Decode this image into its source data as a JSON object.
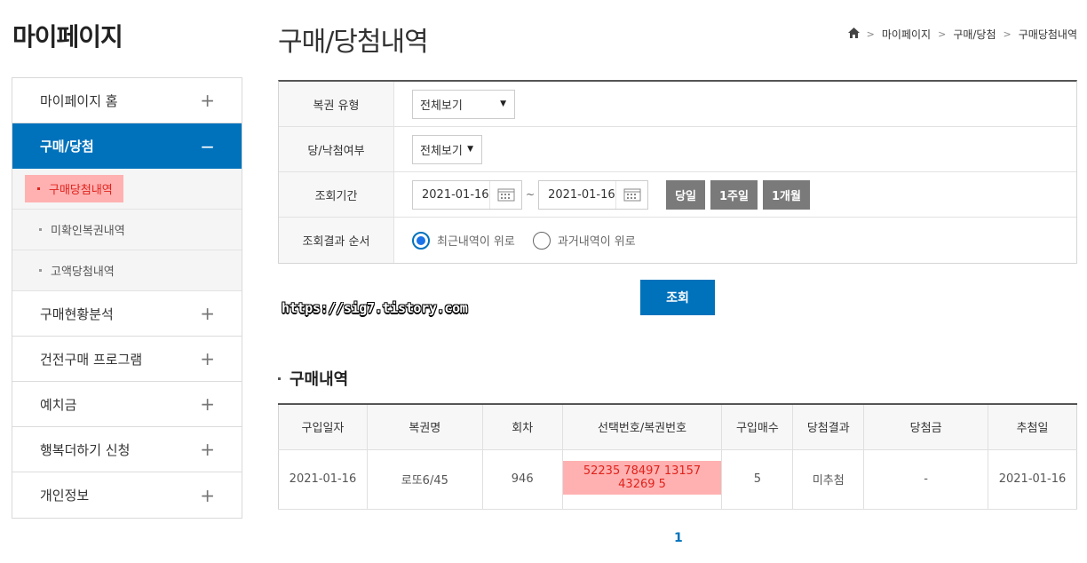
{
  "sidebar": {
    "title": "마이페이지",
    "items": [
      {
        "label": "마이페이지 홈",
        "state": "collapsed"
      },
      {
        "label": "구매/당첨",
        "state": "expanded"
      },
      {
        "label": "구매현황분석",
        "state": "collapsed"
      },
      {
        "label": "건전구매 프로그램",
        "state": "collapsed"
      },
      {
        "label": "예치금",
        "state": "collapsed"
      },
      {
        "label": "행복더하기 신청",
        "state": "collapsed"
      },
      {
        "label": "개인정보",
        "state": "collapsed"
      }
    ],
    "plus_symbol": "+",
    "minus_symbol": "−",
    "subitems": [
      "구매당첨내역",
      "미확인복권내역",
      "고액당첨내역"
    ]
  },
  "header": {
    "title": "구매/당첨내역",
    "breadcrumb": [
      "마이페이지",
      "구매/당첨",
      "구매당첨내역"
    ]
  },
  "search": {
    "lottery_type_label": "복권 유형",
    "lottery_type_value": "전체보기",
    "win_status_label": "당/낙첨여부",
    "win_status_value": "전체보기",
    "period_label": "조회기간",
    "start_date": "2021-01-16",
    "end_date": "2021-01-16",
    "tilde": "~",
    "quick_buttons": [
      "당일",
      "1주일",
      "1개월"
    ],
    "order_label": "조회결과 순서",
    "order_options": [
      "최근내역이 위로",
      "과거내역이 위로"
    ],
    "order_selected": 0,
    "submit_label": "조회"
  },
  "watermark": "https://sig7.tistory.com",
  "results": {
    "section_title": "구매내역",
    "columns": [
      "구입일자",
      "복권명",
      "회차",
      "선택번호/복권번호",
      "구입매수",
      "당첨결과",
      "당첨금",
      "추첨일"
    ],
    "rows": [
      [
        "2021-01-16",
        "로또6/45",
        "946",
        "52235 78497 13157 43269 5",
        "5",
        "미추첨",
        "-",
        "2021-01-16"
      ]
    ]
  },
  "pagination": {
    "current": "1"
  },
  "colors": {
    "accent": "#0072bc",
    "highlight": "#ffb1b1",
    "highlight_text": "#e0231d",
    "gray_button": "#7a7a7a"
  }
}
